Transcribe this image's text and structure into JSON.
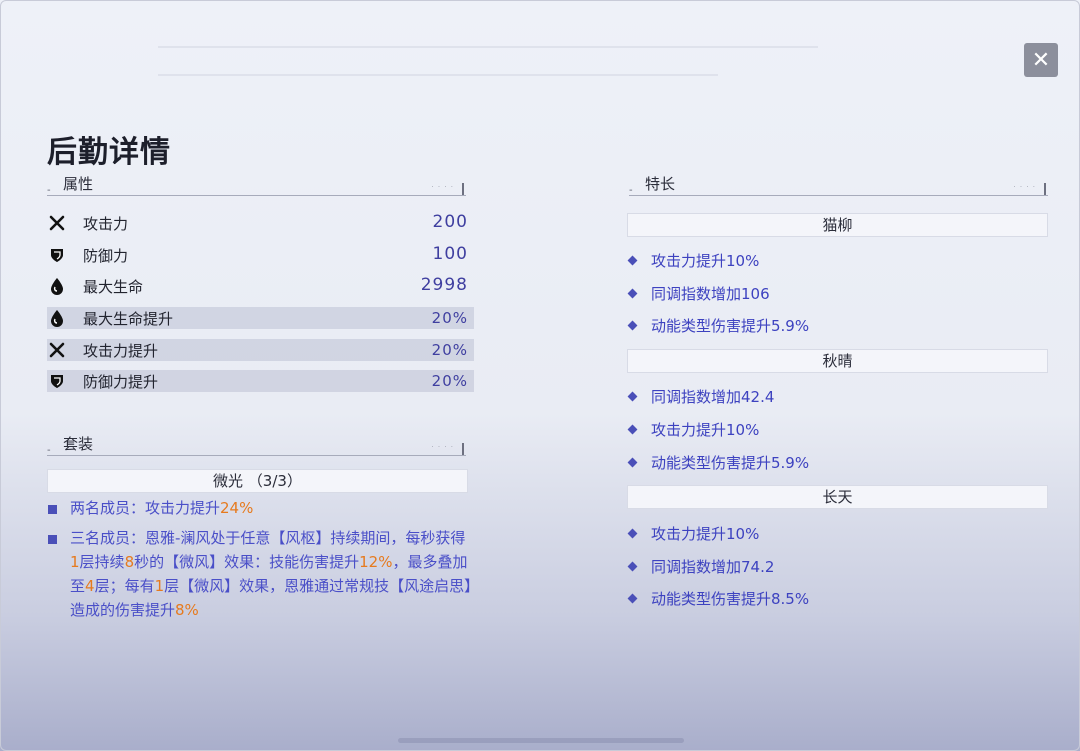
{
  "title": "后勤详情",
  "close": {
    "glyph": "✕"
  },
  "attributes": {
    "header": "属性",
    "rows": [
      {
        "icon": "crossed-swords-icon",
        "label": "攻击力",
        "value": "200",
        "highlight": false
      },
      {
        "icon": "shield-icon",
        "label": "防御力",
        "value": "100",
        "highlight": false
      },
      {
        "icon": "drop-icon",
        "label": "最大生命",
        "value": "2998",
        "highlight": false
      },
      {
        "icon": "drop-icon",
        "label": "最大生命提升",
        "value": "20%",
        "highlight": true
      },
      {
        "icon": "crossed-swords-icon",
        "label": "攻击力提升",
        "value": "20%",
        "highlight": true
      },
      {
        "icon": "shield-icon",
        "label": "防御力提升",
        "value": "20%",
        "highlight": true
      }
    ]
  },
  "set": {
    "header": "套装",
    "name": "微光 （3/3）",
    "effect1": {
      "a": "两名成员：攻击力提升",
      "b": "24%"
    },
    "effect2": {
      "s1": "三名成员：恩雅-澜风处于任意【风枢】持续期间，每秒获得",
      "n1": "1",
      "s2": "层持续",
      "n2": "8",
      "s3": "秒的【微风】效果：技能伤害提升",
      "n3": "12%",
      "s4": "，最多叠加至",
      "n4": "4",
      "s5": "层；每有",
      "n5": "1",
      "s6": "层【微风】效果，恩雅通过常规技【风途启思】造成的伤害提升",
      "n6": "8%"
    }
  },
  "traits": {
    "header": "特长",
    "groups": [
      {
        "name": "猫柳",
        "items": [
          "攻击力提升10%",
          "同调指数增加106",
          "动能类型伤害提升5.9%"
        ]
      },
      {
        "name": "秋晴",
        "items": [
          "同调指数增加42.4",
          "攻击力提升10%",
          "动能类型伤害提升5.9%"
        ]
      },
      {
        "name": "长天",
        "items": [
          "攻击力提升10%",
          "同调指数增加74.2",
          "动能类型伤害提升8.5%"
        ]
      }
    ]
  },
  "colors": {
    "accent": "#4a4fc8",
    "highlight": "#e67a1e",
    "value": "#3f3fa0"
  }
}
